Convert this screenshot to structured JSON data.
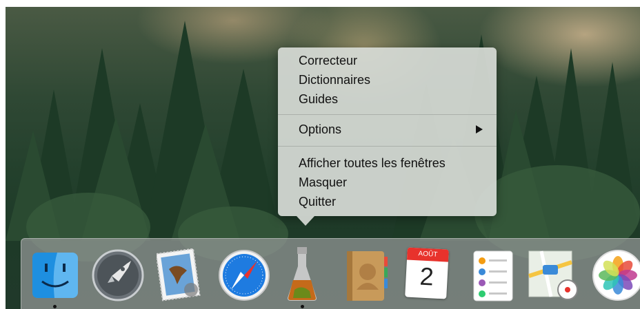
{
  "context_menu": {
    "items": [
      {
        "label": "Correcteur"
      },
      {
        "label": "Dictionnaires"
      },
      {
        "label": "Guides"
      },
      {
        "label": "Options",
        "has_submenu": true
      },
      {
        "label": "Afficher toutes les fenêtres"
      },
      {
        "label": "Masquer"
      },
      {
        "label": "Quitter"
      }
    ]
  },
  "dock": {
    "apps": [
      {
        "icon": "finder-icon",
        "running": true
      },
      {
        "icon": "launchpad-icon",
        "running": false
      },
      {
        "icon": "mail-icon",
        "running": false
      },
      {
        "icon": "safari-icon",
        "running": false
      },
      {
        "icon": "flask-app-icon",
        "running": true
      },
      {
        "icon": "contacts-icon",
        "running": false
      },
      {
        "icon": "calendar-icon",
        "running": false,
        "month": "AOÛT",
        "day": "2"
      },
      {
        "icon": "reminders-icon",
        "running": false
      },
      {
        "icon": "maps-icon",
        "running": false
      },
      {
        "icon": "photos-icon",
        "running": false
      }
    ]
  },
  "colors": {
    "menu_bg": "#d6dad5",
    "dock_bg": "#919694",
    "calendar_red": "#e8322c",
    "safari_blue": "#1e7be0"
  }
}
